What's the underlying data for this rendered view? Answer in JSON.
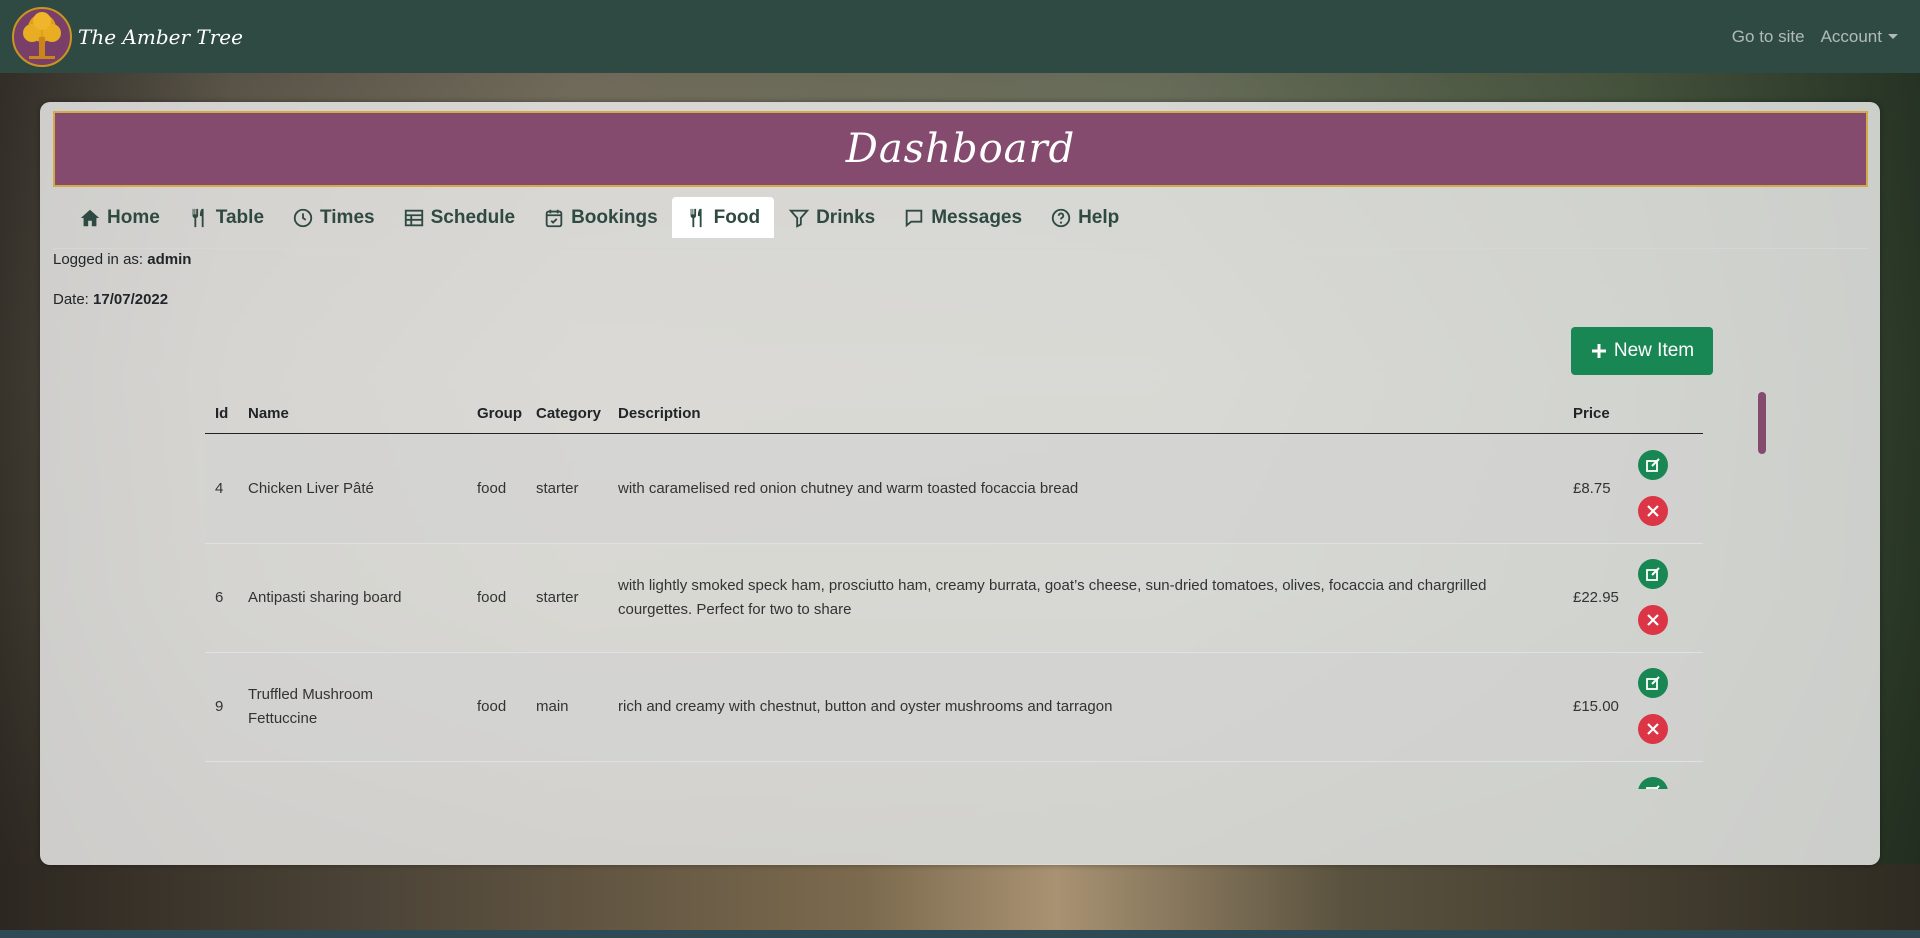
{
  "brand": {
    "name": "The Amber Tree"
  },
  "nav": {
    "go_to_site": "Go to site",
    "account": "Account"
  },
  "dashboard": {
    "title": "Dashboard"
  },
  "tabs": [
    {
      "label": "Home",
      "icon": "home-icon"
    },
    {
      "label": "Table",
      "icon": "utensils-icon"
    },
    {
      "label": "Times",
      "icon": "clock-icon"
    },
    {
      "label": "Schedule",
      "icon": "table-icon"
    },
    {
      "label": "Bookings",
      "icon": "calendar-check-icon"
    },
    {
      "label": "Food",
      "icon": "utensils-icon"
    },
    {
      "label": "Drinks",
      "icon": "filter-icon"
    },
    {
      "label": "Messages",
      "icon": "chat-icon"
    },
    {
      "label": "Help",
      "icon": "question-icon"
    }
  ],
  "active_tab": "Food",
  "session": {
    "logged_in_label": "Logged in as:",
    "user": "admin",
    "date_label": "Date:",
    "date": "17/07/2022"
  },
  "new_item_label": "New Item",
  "table": {
    "headers": {
      "id": "Id",
      "name": "Name",
      "group": "Group",
      "category": "Category",
      "description": "Description",
      "price": "Price"
    },
    "rows": [
      {
        "id": "4",
        "name": "Chicken Liver Pâté",
        "group": "food",
        "category": "starter",
        "description": "with caramelised red onion chutney and warm toasted focaccia bread",
        "price": "£8.75"
      },
      {
        "id": "6",
        "name": "Antipasti sharing board",
        "group": "food",
        "category": "starter",
        "description": "with lightly smoked speck ham, prosciutto ham, creamy burrata, goat’s cheese, sun-dried tomatoes, olives, focaccia and chargrilled courgettes. Perfect for two to share",
        "price": "£22.95"
      },
      {
        "id": "9",
        "name": "Truffled Mushroom Fettuccine",
        "group": "food",
        "category": "main",
        "description": "rich and creamy with chestnut, button and oyster mushrooms and tarragon",
        "price": "£15.00"
      }
    ]
  },
  "colors": {
    "navbar": "#2f4a42",
    "header": "#844b6e",
    "header_border": "#d4a94a",
    "success": "#198754",
    "danger": "#dc3545"
  }
}
